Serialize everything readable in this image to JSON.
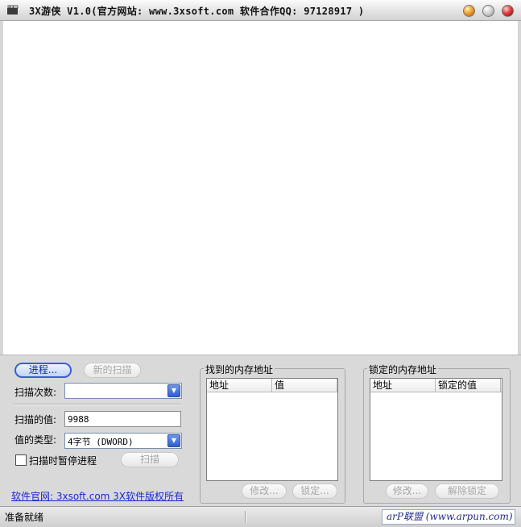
{
  "window": {
    "title": "3X游侠 V1.0(官方网站: www.3xsoft.com 软件合作QQ: 97128917 )"
  },
  "controls": {
    "process_button": "进程...",
    "new_scan_button": "新的扫描",
    "scan_count_label": "扫描次数:",
    "scan_count_value": "",
    "scan_value_label": "扫描的值:",
    "scan_value": "9988",
    "value_type_label": "值的类型:",
    "value_type_selected": "4字节 (DWORD)",
    "pause_checkbox_label": "扫描时暂停进程",
    "pause_checked": false,
    "scan_button": "扫描"
  },
  "found_group": {
    "title": "找到的内存地址",
    "columns": [
      "地址",
      "值"
    ],
    "rows": [],
    "modify_button": "修改...",
    "lock_button": "锁定..."
  },
  "locked_group": {
    "title": "锁定的内存地址",
    "columns": [
      "地址",
      "锁定的值"
    ],
    "rows": [],
    "modify_button": "修改...",
    "unlock_button": "解除锁定"
  },
  "footer_link": "软件官网: 3xsoft.com 3X软件版权所有",
  "status": {
    "text": "准备就绪",
    "brand": "arP联盟 (www.arpun.com)"
  }
}
